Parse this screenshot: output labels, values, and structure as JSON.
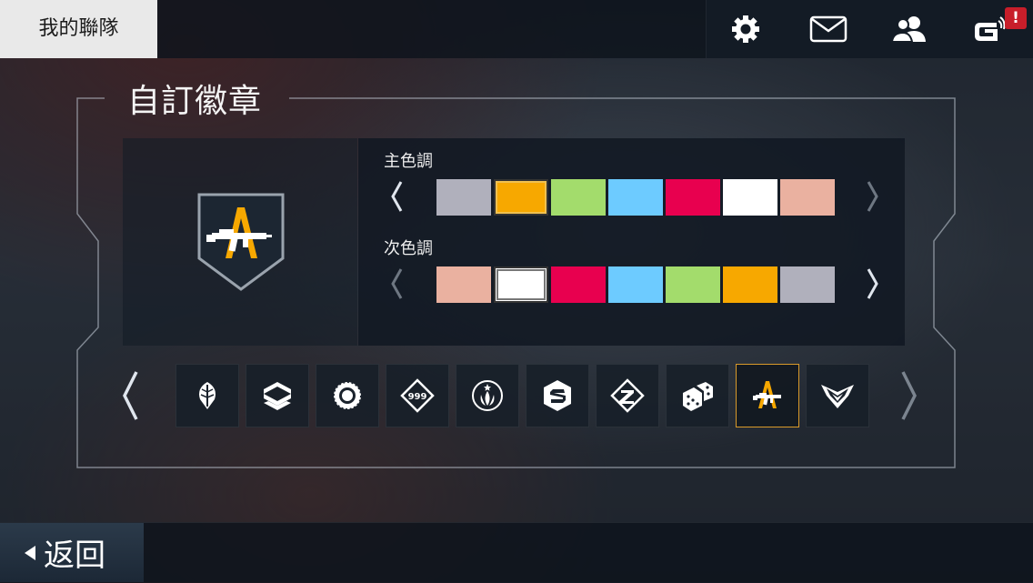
{
  "topbar": {
    "title": "我的聯隊",
    "icons": [
      "gear-icon",
      "mail-icon",
      "friends-icon",
      "gameloft-icon"
    ],
    "notification_badge": "!"
  },
  "panel": {
    "title": "自訂徽章",
    "primary": {
      "label": "主色調",
      "swatches": [
        "#b0b0bc",
        "#f7a800",
        "#a3dc6c",
        "#6dcbff",
        "#e8004f",
        "#ffffff",
        "#eab1a0"
      ],
      "selected_index": 1
    },
    "secondary": {
      "label": "次色調",
      "swatches": [
        "#eab1a0",
        "#ffffff",
        "#e8004f",
        "#6dcbff",
        "#a3dc6c",
        "#f7a800",
        "#b0b0bc"
      ],
      "selected_index": 1
    },
    "emblems": [
      {
        "name": "feather-emblem"
      },
      {
        "name": "chevron-layers-emblem"
      },
      {
        "name": "saw-blade-emblem"
      },
      {
        "name": "999-diamond-emblem",
        "text": "999"
      },
      {
        "name": "flame-star-emblem"
      },
      {
        "name": "s-hexagon-emblem"
      },
      {
        "name": "z-diamond-emblem"
      },
      {
        "name": "dice-emblem"
      },
      {
        "name": "rifle-emblem"
      },
      {
        "name": "wings-emblem"
      }
    ],
    "selected_emblem_index": 8
  },
  "footer": {
    "back_label": "返回"
  },
  "colors": {
    "accent": "#f7a800",
    "selected_border": "#d99a2a"
  }
}
